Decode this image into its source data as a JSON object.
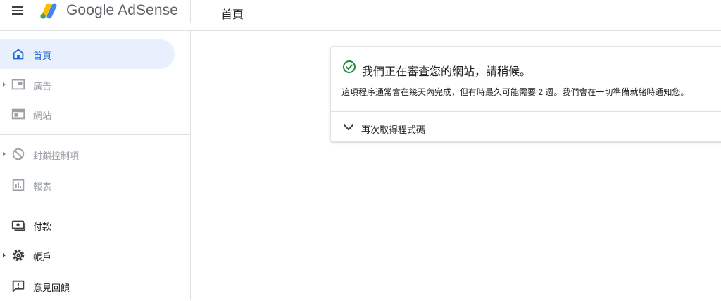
{
  "header": {
    "brand": "Google AdSense",
    "page_title": "首頁"
  },
  "sidebar": {
    "items": [
      {
        "label": "首頁",
        "icon": "home-icon",
        "state": "active"
      },
      {
        "label": "廣告",
        "icon": "ads-icon",
        "state": "disabled",
        "expandable": true
      },
      {
        "label": "網站",
        "icon": "sites-icon",
        "state": "disabled"
      },
      {
        "label": "封鎖控制項",
        "icon": "block-icon",
        "state": "disabled",
        "expandable": true
      },
      {
        "label": "報表",
        "icon": "reports-icon",
        "state": "disabled"
      },
      {
        "label": "付款",
        "icon": "payments-icon",
        "state": "normal"
      },
      {
        "label": "帳戶",
        "icon": "gear-icon",
        "state": "normal",
        "expandable": true
      },
      {
        "label": "意見回饋",
        "icon": "feedback-icon",
        "state": "normal"
      }
    ]
  },
  "card": {
    "title": "我們正在審查您的網站，請稍候。",
    "description": "這項程序通常會在幾天內完成，但有時最久可能需要 2 週。我們會在一切準備就緒時通知您。",
    "expand_label": "再次取得程式碼"
  },
  "colors": {
    "accent": "#1967d2",
    "active_bg": "#e8f0fe",
    "success": "#1e8e3e",
    "disabled": "#9aa0a6"
  }
}
